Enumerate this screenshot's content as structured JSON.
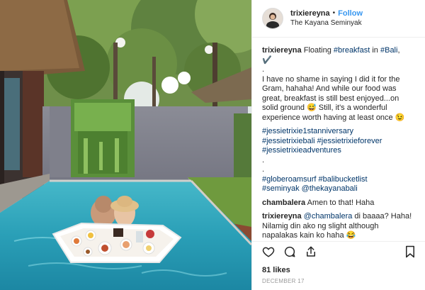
{
  "post": {
    "username": "trixiereyna",
    "follow_label": "Follow",
    "location": "The Kayana Seminyak",
    "caption": {
      "user": "trixiereyna",
      "intro": "Floating ",
      "tag1": "#breakfast",
      "in": " in ",
      "tag2": "#Bali",
      "after": ",",
      "check": "✔️",
      "dot1": ".",
      "body": "I have no shame in saying I did it for the Gram, hahaha! And while our food was great, breakfast is still best enjoyed...on solid ground 😅 Still, it's a wonderful experience worth having at least once 😉",
      "tag3": "#jessietrixie1stanniversary",
      "tag4": "#jessietrixiebali",
      "tag5": "#jessietrixieforever",
      "tag6": "#jessietrixieadventures",
      "dot2": ".",
      "dot3": ".",
      "tag7": "#globeroamsurf",
      "tag8": "#balibucketlist",
      "tag9": "#seminyak",
      "mention1": "@thekayanabali"
    },
    "comments": [
      {
        "user": "chambalera",
        "text": "Amen to that! Haha"
      },
      {
        "user": "trixiereyna",
        "mention": "@chambalera",
        "text": " di baaaa? Haha! Nilamig din ako ng slight although napalakas kain ko haha 😂"
      }
    ],
    "likes": "81 likes",
    "date": "DECEMBER 17"
  },
  "icons": {
    "like": "heart-icon",
    "comment": "comment-icon",
    "share": "share-icon",
    "save": "bookmark-icon"
  },
  "colors": {
    "follow": "#3897f0",
    "hashtag": "#003569",
    "text": "#262626",
    "muted": "#999999"
  }
}
